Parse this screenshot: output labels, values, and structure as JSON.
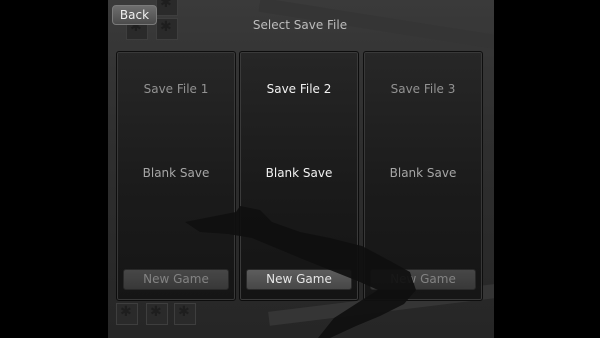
{
  "header": {
    "back_label": "Back",
    "title": "Select Save File"
  },
  "save_files": [
    {
      "label": "Save File 1",
      "status": "Blank Save",
      "action": "New Game",
      "active": false
    },
    {
      "label": "Save File 2",
      "status": "Blank Save",
      "action": "New Game",
      "active": true
    },
    {
      "label": "Save File 3",
      "status": "Blank Save",
      "action": "New Game",
      "active": false
    }
  ],
  "colors": {
    "panel": "#1c1c1c",
    "text_active": "#f2f2f2",
    "text_dim": "#9a9a9a",
    "button": "#4a4a4a"
  }
}
